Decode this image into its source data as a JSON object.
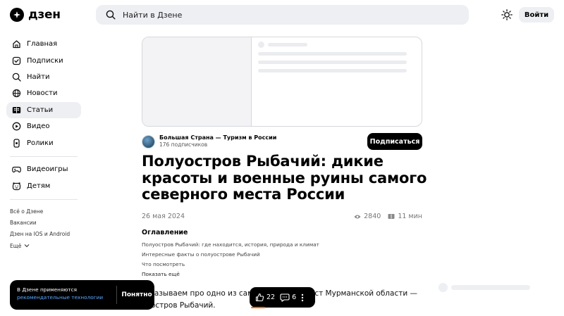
{
  "header": {
    "logo_text": "дзен",
    "search_placeholder": "Найти в Дзене",
    "login_label": "Войти"
  },
  "sidebar": {
    "items": [
      {
        "label": "Главная",
        "icon": "home-icon"
      },
      {
        "label": "Подписки",
        "icon": "subscriptions-icon"
      },
      {
        "label": "Найти",
        "icon": "search-icon"
      },
      {
        "label": "Новости",
        "icon": "news-icon"
      },
      {
        "label": "Статьи",
        "icon": "articles-icon",
        "active": true
      },
      {
        "label": "Видео",
        "icon": "video-icon"
      },
      {
        "label": "Ролики",
        "icon": "shorts-icon"
      }
    ],
    "items2": [
      {
        "label": "Видеоигры",
        "icon": "gamepad-icon"
      },
      {
        "label": "Детям",
        "icon": "kids-icon"
      }
    ],
    "footer_links": [
      "Всё о Дзене",
      "Вакансии",
      "Дзен на IOS и Android",
      "Ещё"
    ]
  },
  "channel": {
    "name": "Большая Страна — Туризм в России",
    "subscribers": "176 подписчиков",
    "subscribe_label": "Подписаться"
  },
  "article": {
    "title": "Полуостров Рыбачий: дикие красоты и военные руины самого северного места России",
    "date": "26 мая 2024",
    "views": "2840",
    "read_time": "11 мин",
    "toc_title": "Оглавление",
    "toc_items": [
      "Полуостров Рыбачий: где находится, история, природа и климат",
      "Интересные факты о полуострове Рыбачий",
      "Что посмотреть"
    ],
    "toc_more": "Показать ещё",
    "body_line1_a": "ссказываем про одно из самы",
    "body_line1_b": "ст Мурманской области —",
    "body_line2": "луостров Рыбачий."
  },
  "cookie": {
    "text": "В Дзене применяются",
    "link": "рекомендательные технологии",
    "button": "Понятно"
  },
  "reactions": {
    "likes": "22",
    "comments": "6"
  },
  "colors": {
    "accent_link": "#5aa9ff",
    "progress": "#ff6a00",
    "chip_bg": "#eeeff2"
  }
}
